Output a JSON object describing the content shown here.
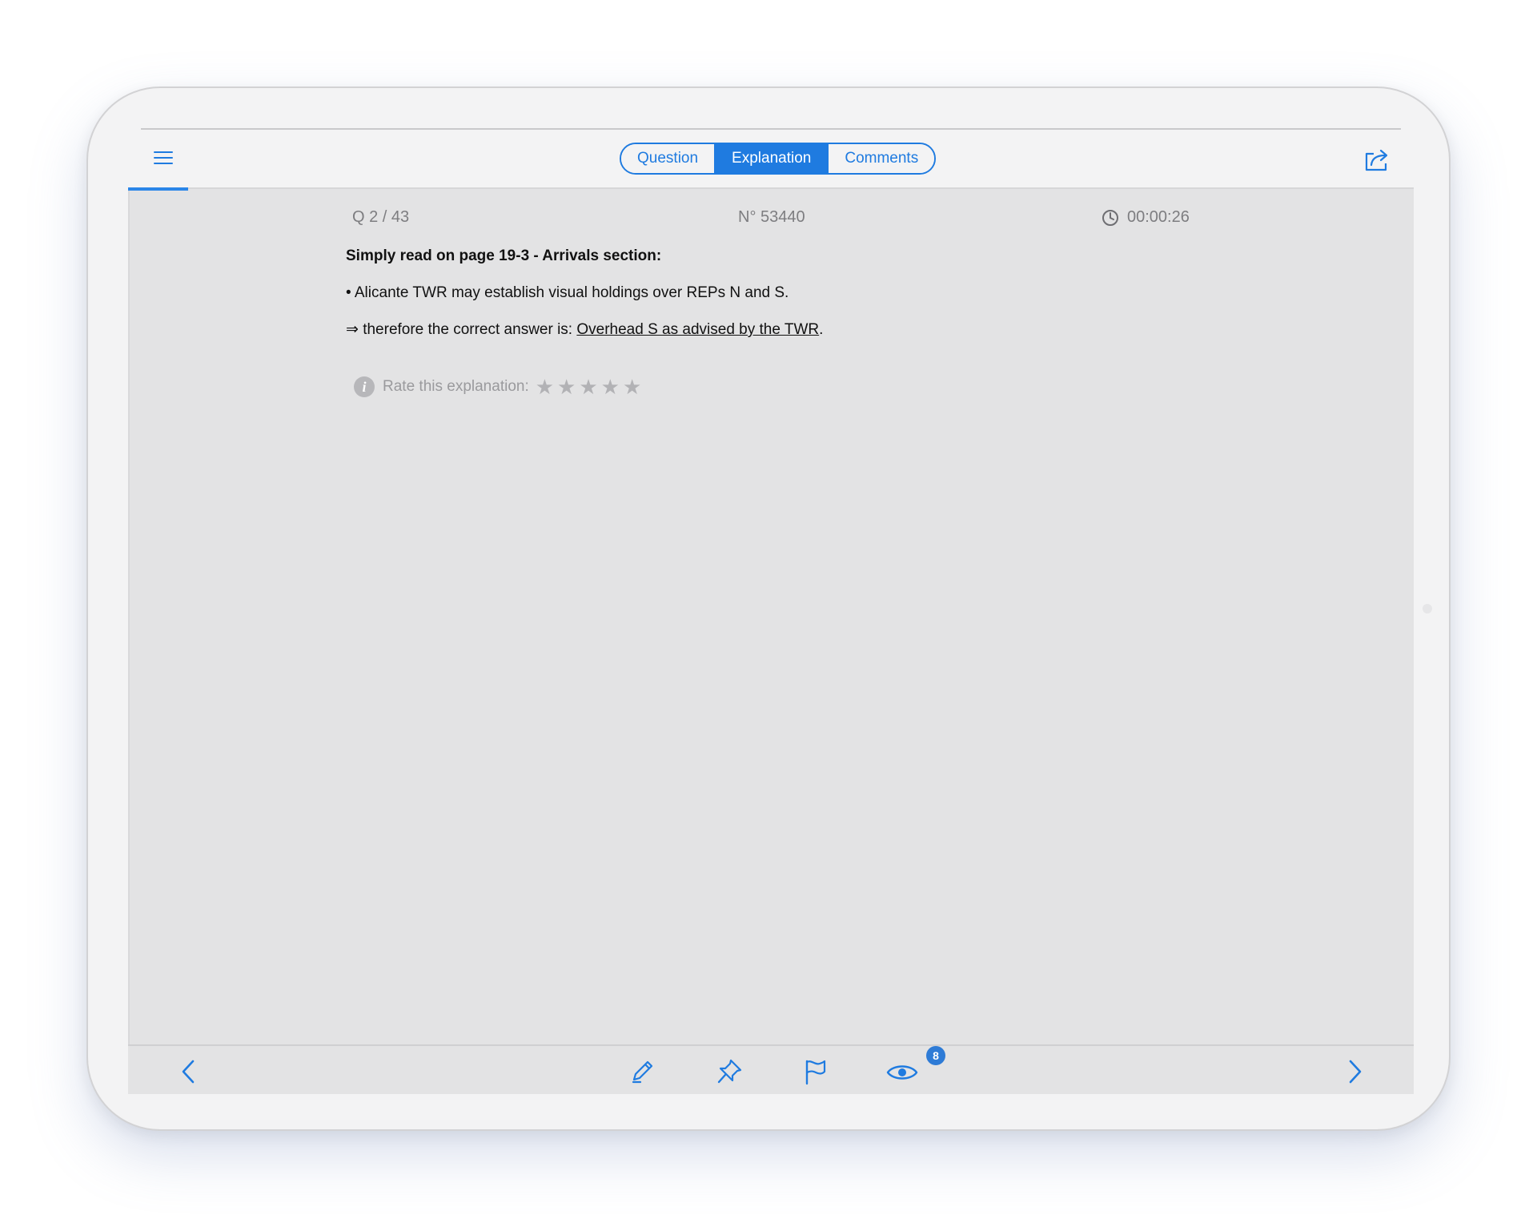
{
  "tabs": [
    {
      "label": "Question",
      "active": false
    },
    {
      "label": "Explanation",
      "active": true
    },
    {
      "label": "Comments",
      "active": false
    }
  ],
  "progress": {
    "current": 2,
    "total": 43
  },
  "meta": {
    "question_counter": "Q  2 / 43",
    "question_id": "N° 53440",
    "timer": "00:00:26"
  },
  "explanation": {
    "heading": "Simply read on page 19-3 - Arrivals section:",
    "bullet": "• Alicante TWR may establish visual holdings over REPs N and S.",
    "conclusion_prefix": "⇒ therefore the correct answer is: ",
    "answer_link": "Overhead S as advised by the TWR",
    "conclusion_suffix": "."
  },
  "rating": {
    "label": "Rate this explanation:",
    "star_glyph": "★",
    "max_stars": 5,
    "value": 0
  },
  "toolbar": {
    "views_badge": "8"
  },
  "colors": {
    "accent": "#1f7be0",
    "screen_bg": "#e3e3e4",
    "bar_bg": "#f3f3f4",
    "muted_text": "#7d7d80",
    "star": "#b2b2b5",
    "badge": "#2e7bd6"
  },
  "icons": {
    "menu": "hamburger-menu-icon",
    "share": "share-icon",
    "timer": "clock-icon",
    "info": "info-icon",
    "prev": "chevron-left-icon",
    "next": "chevron-right-icon",
    "note": "pencil-icon",
    "pin": "pin-icon",
    "flag": "flag-icon",
    "views": "eye-icon"
  }
}
